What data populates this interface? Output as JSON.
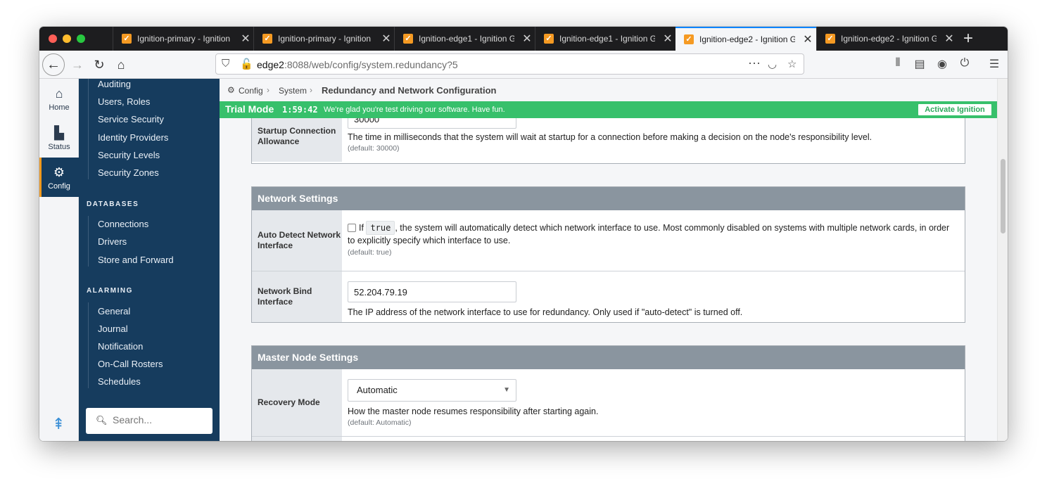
{
  "browser": {
    "tabs": [
      {
        "title": "Ignition-primary - Ignition G"
      },
      {
        "title": "Ignition-primary - Ignition G"
      },
      {
        "title": "Ignition-edge1 - Ignition G"
      },
      {
        "title": "Ignition-edge1 - Ignition G"
      },
      {
        "title": "Ignition-edge2 - Ignition G"
      },
      {
        "title": "Ignition-edge2 - Ignition G"
      }
    ],
    "active_tab": 4,
    "url_host": "edge2",
    "url_rest": ":8088/web/config/system.redundancy?5",
    "colors": {
      "tab_strip": "#1d1d1f",
      "favicon": "#f59a23",
      "active_accent": "#0a84ff"
    }
  },
  "leftnav": {
    "items": [
      {
        "label": "Home",
        "icon": "home-icon"
      },
      {
        "label": "Status",
        "icon": "bar-chart-icon"
      },
      {
        "label": "Config",
        "icon": "gear-icon"
      }
    ],
    "active": "Config",
    "colors": {
      "active_bg": "#163c5e",
      "active_marker": "#f39a1e"
    }
  },
  "sidebar": {
    "top_items": [
      "Auditing",
      "Users, Roles",
      "Service Security",
      "Identity Providers",
      "Security Levels",
      "Security Zones"
    ],
    "databases": {
      "heading": "DATABASES",
      "items": [
        "Connections",
        "Drivers",
        "Store and Forward"
      ]
    },
    "alarming": {
      "heading": "ALARMING",
      "items": [
        "General",
        "Journal",
        "Notification",
        "On-Call Rosters",
        "Schedules"
      ]
    },
    "search_placeholder": "Search...",
    "colors": {
      "bg": "#163c5e"
    }
  },
  "breadcrumb": {
    "items": [
      "Config",
      "System"
    ],
    "current": "Redundancy and Network Configuration"
  },
  "trial": {
    "mode_label": "Trial Mode",
    "time": "1:59:42",
    "message": "We're glad you're test driving our software. Have fun.",
    "activate_label": "Activate Ignition",
    "colors": {
      "bar": "#37c06b"
    }
  },
  "startup": {
    "label": "Startup Connection Allowance",
    "value": "30000",
    "description": "The time in milliseconds that the system will wait at startup for a connection before making a decision on the node's responsibility level.",
    "default": "(default: 30000)"
  },
  "network_settings": {
    "title": "Network Settings",
    "auto_detect": {
      "label": "Auto Detect Network Interface",
      "checked": false,
      "text_before": "If",
      "code": "true",
      "text_after": ", the system will automatically detect which network interface to use. Most commonly disabled on systems with multiple network cards, in order to explicitly specify which interface to use.",
      "default": "(default: true)"
    },
    "bind_interface": {
      "label": "Network Bind Interface",
      "value": "52.204.79.19",
      "description": "The IP address of the network interface to use for redundancy. Only used if \"auto-detect\" is turned off."
    }
  },
  "master_node": {
    "title": "Master Node Settings",
    "recovery_mode": {
      "label": "Recovery Mode",
      "selected": "Automatic",
      "description": "How the master node resumes responsibility after starting again.",
      "default": "(default: Automatic)"
    }
  },
  "colors": {
    "panel_head": "#8a959f",
    "row_label_bg": "#e5e8ec"
  }
}
